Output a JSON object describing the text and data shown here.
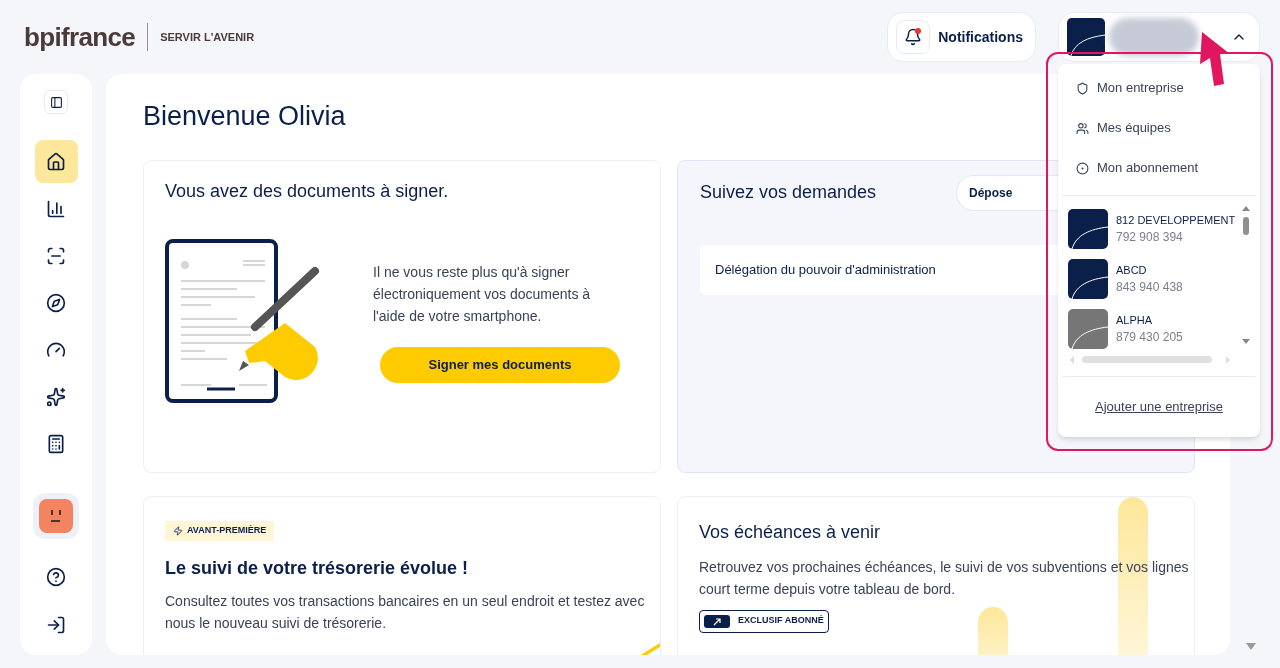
{
  "header": {
    "brand": "bpifrance",
    "tagline": "SERVIR L'AVENIR",
    "notifications": {
      "label": "Notifications",
      "unread": true
    },
    "account": {
      "expanded": true
    }
  },
  "sidebar": {
    "items": [
      {
        "kind": "home",
        "selected": true
      },
      {
        "kind": "chart",
        "selected": false
      },
      {
        "kind": "screen",
        "selected": false
      },
      {
        "kind": "compass",
        "selected": false
      },
      {
        "kind": "gauge",
        "selected": false
      },
      {
        "kind": "sparkles",
        "selected": false
      },
      {
        "kind": "calculator",
        "selected": false
      }
    ],
    "bottom": [
      {
        "kind": "avatar"
      },
      {
        "kind": "help"
      },
      {
        "kind": "logout"
      }
    ]
  },
  "main": {
    "greeting": "Bienvenue Olivia",
    "sign_card": {
      "title": "Vous avez des documents à signer.",
      "text": "Il ne vous reste plus qu'à signer électroniquement vos documents à l'aide de votre smartphone.",
      "button": "Signer mes documents"
    },
    "requests_card": {
      "title": "Suivez vos demandes",
      "button": "Dépose",
      "rows": [
        "Délégation du pouvoir d'administration"
      ]
    },
    "treasury_card": {
      "badge": "AVANT-PREMIÈRE",
      "title": "Le suivi de votre trésorerie évolue !",
      "text": "Consultez toutes vos transactions bancaires en un seul endroit et testez avec nous le nouveau suivi de trésorerie."
    },
    "deadlines_card": {
      "title": "Vos échéances à venir",
      "text": "Retrouvez vos prochaines échéances, le suivi de vos subventions et vos lignes court terme depuis votre tableau de bord.",
      "badge": "EXCLUSIF ABONNÉ"
    }
  },
  "account_menu": {
    "items": [
      {
        "kind": "shield",
        "label": "Mon entreprise"
      },
      {
        "kind": "team",
        "label": "Mes équipes"
      },
      {
        "kind": "subscription",
        "label": "Mon abonnement"
      }
    ],
    "companies": [
      {
        "name": "812 DEVELOPPEMENT",
        "siren": "792 908 394",
        "color": "#0b1f4b"
      },
      {
        "name": "ABCD",
        "siren": "843 940 438",
        "color": "#0b1f4b"
      },
      {
        "name": "ALPHA",
        "siren": "879 430 205",
        "color": "#767676"
      }
    ],
    "add_link": "Ajouter une entreprise"
  }
}
